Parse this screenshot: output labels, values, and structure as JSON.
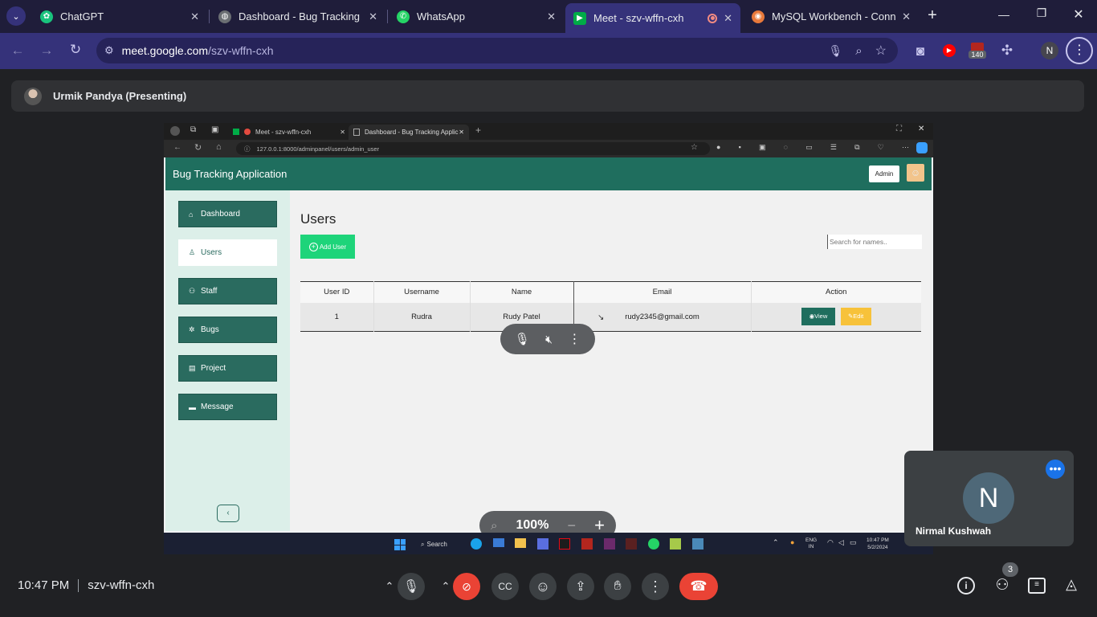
{
  "chrome": {
    "tabs": [
      {
        "title": "ChatGPT",
        "icon": "chatgpt-icon",
        "color": "#19c37d"
      },
      {
        "title": "Dashboard - Bug Tracking Ap",
        "icon": "globe-icon",
        "color": "#9aa0a6"
      },
      {
        "title": "WhatsApp",
        "icon": "whatsapp-icon",
        "color": "#25d366"
      },
      {
        "title": "Meet - szv-wffn-cxh",
        "icon": "meet-icon",
        "color": "#00ac47"
      },
      {
        "title": "MySQL Workbench - Connec",
        "icon": "mysql-icon",
        "color": "#e8793b"
      }
    ],
    "url_host": "meet.google.com",
    "url_path": "/szv-wffn-cxh",
    "profile_initial": "N",
    "badge_count": "140"
  },
  "meet": {
    "presenter": "Urmik Pandya (Presenting)",
    "zoom": "100%",
    "participant_tile_name": "Nirmal Kushwah",
    "participant_tile_initial": "N",
    "time": "10:47 PM",
    "meeting_code": "szv-wffn-cxh",
    "people_count": "3"
  },
  "shared": {
    "tabs": [
      {
        "title": "Meet - szv-wffn-cxh"
      },
      {
        "title": "Dashboard - Bug Tracking Applic"
      }
    ],
    "url": "127.0.0.1:8000/adminpanel/users/admin_user",
    "app_title": "Bug Tracking Application",
    "admin_label": "Admin",
    "sidebar": [
      {
        "label": "Dashboard",
        "icon": "home-icon",
        "glyph": "⌂"
      },
      {
        "label": "Users",
        "icon": "user-icon",
        "glyph": "♙"
      },
      {
        "label": "Staff",
        "icon": "staff-icon",
        "glyph": "⚇"
      },
      {
        "label": "Bugs",
        "icon": "bug-icon",
        "glyph": "✲"
      },
      {
        "label": "Project",
        "icon": "project-icon",
        "glyph": "▤"
      },
      {
        "label": "Message",
        "icon": "message-icon",
        "glyph": "▬"
      }
    ],
    "page_title": "Users",
    "add_user": "Add User",
    "search_placeholder": "Search for names..",
    "columns": [
      "User ID",
      "Username",
      "Name",
      "Email",
      "Action"
    ],
    "rows": [
      {
        "id": "1",
        "username": "Rudra",
        "name": "Rudy  Patel",
        "email": "rudy2345@gmail.com"
      }
    ],
    "view_label": "View",
    "edit_label": "Edit",
    "taskbar_search": "Search",
    "taskbar_lang1": "ENG",
    "taskbar_lang2": "IN",
    "taskbar_time": "10:47 PM",
    "taskbar_date": "5/2/2024"
  },
  "colors": {
    "app_header": "#1f6e5e",
    "sidebar_button": "#2a6b5f",
    "add_user": "#1ed47a",
    "edit": "#f7c23a",
    "end_call": "#ea4335",
    "chrome_bar": "#35327a"
  }
}
